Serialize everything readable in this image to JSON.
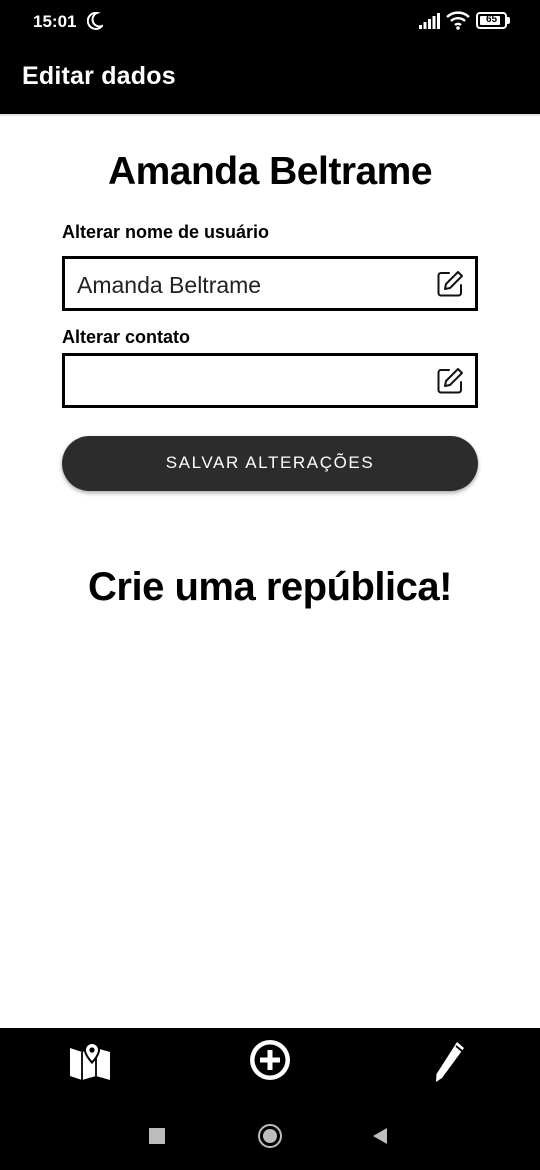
{
  "status_bar": {
    "time": "15:01",
    "battery_level": "65",
    "icons": [
      "moon-icon",
      "signal-icon",
      "wifi-icon",
      "battery-icon"
    ]
  },
  "app_bar": {
    "title": "Editar dados"
  },
  "profile": {
    "name": "Amanda Beltrame"
  },
  "form": {
    "username": {
      "label": "Alterar nome de usuário",
      "value": "Amanda Beltrame",
      "icon": "edit-icon"
    },
    "contact": {
      "label": "Alterar contato",
      "value": "",
      "icon": "edit-icon"
    },
    "save_label": "SALVAR ALTERAÇÕES"
  },
  "section": {
    "heading": "Crie uma república!"
  },
  "bottom_nav": {
    "items": [
      "map-pin-icon",
      "add-circle-icon",
      "pencil-icon"
    ]
  },
  "system_nav": {
    "buttons": [
      "recents",
      "home",
      "back"
    ]
  },
  "colors": {
    "bars": "#000000",
    "button": "#2c2c2c",
    "background": "#ffffff"
  }
}
